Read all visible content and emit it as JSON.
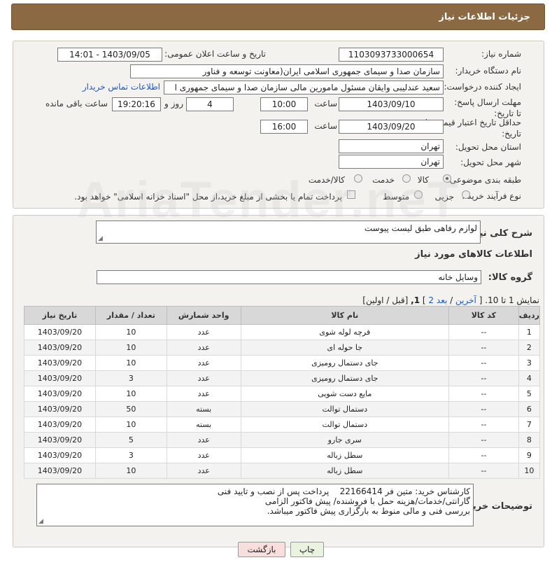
{
  "header": {
    "title": "جزئیات اطلاعات نیاز"
  },
  "form": {
    "need_number": {
      "label": "شماره نیاز:",
      "value": "1103093733000654"
    },
    "announce_datetime": {
      "label": "تاریخ و ساعت اعلان عمومی:",
      "value": "1403/09/05 - 14:01"
    },
    "buyer_org": {
      "label": "نام دستگاه خریدار:",
      "value": "سازمان صدا و سیمای جمهوری اسلامی ایران(معاونت توسعه و فناور"
    },
    "requester": {
      "label": "ایجاد کننده درخواست:",
      "value": "سعید عندلیبی وایقان مسئول مامورین مالی  سازمان صدا و سیمای جمهوری ا",
      "contact_link": "اطلاعات تماس خریدار"
    },
    "send_deadline": {
      "label": "مهلت ارسال پاسخ: تا تاریخ:",
      "date": "1403/09/10",
      "time_label": "ساعت",
      "time": "10:00",
      "days": "4",
      "days_label": "روز و",
      "remaining": "19:20:16",
      "remaining_label": "ساعت باقی مانده"
    },
    "price_validity": {
      "label": "حداقل تاریخ اعتبار قیمت: تا تاریخ:",
      "date": "1403/09/20",
      "time_label": "ساعت",
      "time": "16:00"
    },
    "delivery_province": {
      "label": "استان محل تحویل:",
      "value": "تهران"
    },
    "delivery_city": {
      "label": "شهر محل تحویل:",
      "value": "تهران"
    },
    "category": {
      "label": "طبقه بندی موضوعی:",
      "options": [
        "کالا",
        "خدمت",
        "کالا/خدمت"
      ],
      "selected": "کالا"
    },
    "process_type": {
      "label": "نوع فرآیند خرید :",
      "options": [
        "جزیی",
        "متوسط"
      ],
      "note": "پرداخت تمام یا بخشی از مبلغ خرید،از محل \"اسناد خزانه اسلامی\" خواهد بود."
    }
  },
  "summary": {
    "general_desc_label": "شرح کلی نیاز:",
    "general_desc": "لوازم رفاهی طبق لیست پیوست",
    "goods_info_title": "اطلاعات کالاهای مورد نیاز",
    "goods_group_label": "گروه کالا:",
    "goods_group": "وسایل خانه"
  },
  "pagination": {
    "showing": "نمایش 1 تا 10.",
    "bracket_open": "[",
    "last": "آخرین",
    "sep1": "/",
    "next": "بعد",
    "bracket_close": "]",
    "page2": "2",
    "page1": "1,",
    "rest": "[قبل / اولین]"
  },
  "table": {
    "headers": [
      "ردیف",
      "کد کالا",
      "نام کالا",
      "واحد شمارش",
      "تعداد / مقدار",
      "تاریخ نیاز"
    ],
    "rows": [
      [
        "1",
        "--",
        "فرچه لوله شوی",
        "عدد",
        "10",
        "1403/09/20"
      ],
      [
        "2",
        "--",
        "جا حوله ای",
        "عدد",
        "10",
        "1403/09/20"
      ],
      [
        "3",
        "--",
        "جای دستمال رومیزی",
        "عدد",
        "10",
        "1403/09/20"
      ],
      [
        "4",
        "--",
        "جای دستمال رومیزی",
        "عدد",
        "3",
        "1403/09/20"
      ],
      [
        "5",
        "--",
        "مایع دست شویی",
        "عدد",
        "10",
        "1403/09/20"
      ],
      [
        "6",
        "--",
        "دستمال توالت",
        "بسته",
        "50",
        "1403/09/20"
      ],
      [
        "7",
        "--",
        "دستمال توالت",
        "بسته",
        "10",
        "1403/09/20"
      ],
      [
        "8",
        "--",
        "سری جارو",
        "عدد",
        "5",
        "1403/09/20"
      ],
      [
        "9",
        "--",
        "سطل زباله",
        "عدد",
        "3",
        "1403/09/20"
      ],
      [
        "10",
        "--",
        "سطل زباله",
        "عدد",
        "10",
        "1403/09/20"
      ]
    ]
  },
  "buyer_notes": {
    "label": "توضیحات خریدار:",
    "text": "کارشناس خرید: متین فر 22166414    پرداخت پس از نصب و تایید فنی\nگارانتی/خدمات/هزینه حمل با فروشنده/ پیش فاکتور الزامی\nبررسی فنی و مالی منوط به بارگزاری پیش فاکتور میباشد."
  },
  "buttons": {
    "print": "چاپ",
    "back": "بازگشت"
  },
  "watermark": "AriaTender.neT"
}
